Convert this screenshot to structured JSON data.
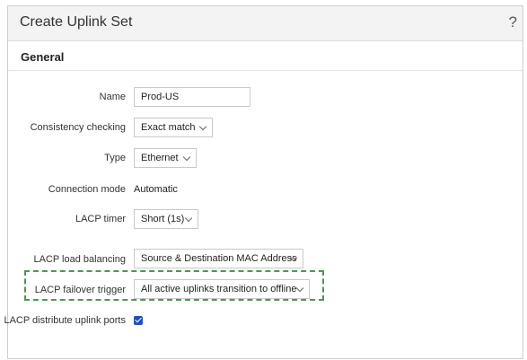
{
  "dialog": {
    "title": "Create Uplink Set",
    "help_glyph": "?"
  },
  "section": {
    "title": "General"
  },
  "fields": {
    "name": {
      "label": "Name",
      "value": "Prod-US"
    },
    "consistency": {
      "label": "Consistency checking",
      "value": "Exact match"
    },
    "type": {
      "label": "Type",
      "value": "Ethernet"
    },
    "connection_mode": {
      "label": "Connection mode",
      "value": "Automatic"
    },
    "lacp_timer": {
      "label": "LACP timer",
      "value": "Short (1s)"
    },
    "lacp_load_balancing": {
      "label": "LACP load balancing",
      "value": "Source & Destination MAC Address"
    },
    "lacp_failover_trigger": {
      "label": "LACP failover trigger",
      "value": "All active uplinks transition to offline"
    },
    "lacp_distribute": {
      "label": "LACP distribute uplink ports",
      "checked": true
    }
  },
  "colors": {
    "highlight_border": "#4a9a4a",
    "checkbox_fill": "#1e4fc2"
  }
}
